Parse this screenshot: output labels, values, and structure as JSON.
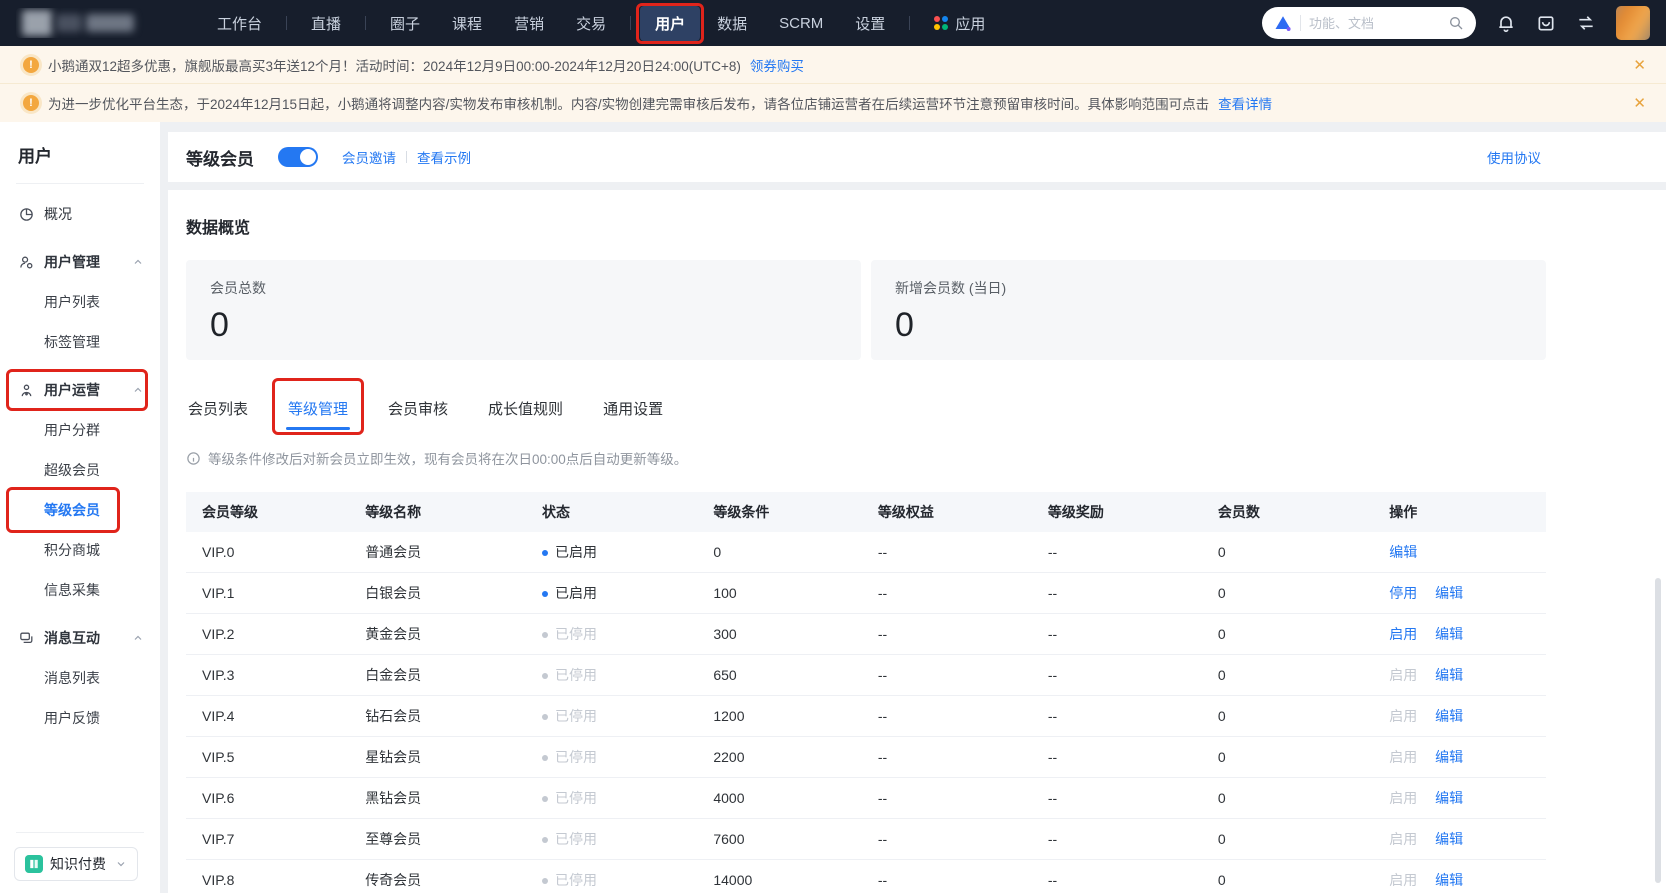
{
  "colors": {
    "accent": "#2478f2",
    "annotation": "#e0241b",
    "warn": "#f3a73f"
  },
  "topnav": {
    "items": [
      "工作台",
      "直播",
      "圈子",
      "课程",
      "营销",
      "交易",
      "用户",
      "数据",
      "SCRM",
      "设置",
      "应用"
    ],
    "active": "用户",
    "search": {
      "placeholder": "功能、文档"
    }
  },
  "banners": {
    "b1": {
      "text": "小鹅通双12超多优惠，旗舰版最高买3年送12个月！活动时间：2024年12月9日00:00-2024年12月20日24:00(UTC+8)",
      "link": "领券购买"
    },
    "b2": {
      "text": "为进一步优化平台生态，于2024年12月15日起，小鹅通将调整内容/实物发布审核机制。内容/实物创建完需审核后发布，请各位店铺运营者在后续运营环节注意预留审核时间。具体影响范围可点击",
      "link": "查看详情"
    }
  },
  "sidebar": {
    "title": "用户",
    "overview": "概况",
    "groups": [
      {
        "label": "用户管理",
        "children": [
          "用户列表",
          "标签管理"
        ]
      },
      {
        "label": "用户运营",
        "children": [
          "用户分群",
          "超级会员",
          "等级会员",
          "积分商城",
          "信息采集"
        ]
      },
      {
        "label": "消息互动",
        "children": [
          "消息列表",
          "用户反馈"
        ]
      }
    ],
    "selected": "等级会员",
    "bottom": {
      "label": "知识付费"
    }
  },
  "header": {
    "title": "等级会员",
    "toggle_on": true,
    "links": [
      "会员邀请",
      "查看示例"
    ],
    "right_link": "使用协议"
  },
  "overview": {
    "title": "数据概览",
    "cards": [
      {
        "label": "会员总数",
        "value": "0"
      },
      {
        "label": "新增会员数 (当日)",
        "value": "0"
      }
    ]
  },
  "tabs": {
    "items": [
      "会员列表",
      "等级管理",
      "会员审核",
      "成长值规则",
      "通用设置"
    ],
    "active": "等级管理"
  },
  "notice": {
    "text": "等级条件修改后对新会员立即生效，现有会员将在次日00:00点后自动更新等级。"
  },
  "table": {
    "columns": [
      "会员等级",
      "等级名称",
      "状态",
      "等级条件",
      "等级权益",
      "等级奖励",
      "会员数",
      "操作"
    ],
    "rows": [
      {
        "level": "VIP.0",
        "name": "普通会员",
        "status": "已启用",
        "condition": "0",
        "benefit": "--",
        "reward": "--",
        "count": "0",
        "actions": [
          {
            "label": "编辑",
            "disabled": false
          }
        ]
      },
      {
        "level": "VIP.1",
        "name": "白银会员",
        "status": "已启用",
        "condition": "100",
        "benefit": "--",
        "reward": "--",
        "count": "0",
        "actions": [
          {
            "label": "停用",
            "disabled": false
          },
          {
            "label": "编辑",
            "disabled": false
          }
        ]
      },
      {
        "level": "VIP.2",
        "name": "黄金会员",
        "status": "已停用",
        "condition": "300",
        "benefit": "--",
        "reward": "--",
        "count": "0",
        "actions": [
          {
            "label": "启用",
            "disabled": false
          },
          {
            "label": "编辑",
            "disabled": false
          }
        ]
      },
      {
        "level": "VIP.3",
        "name": "白金会员",
        "status": "已停用",
        "condition": "650",
        "benefit": "--",
        "reward": "--",
        "count": "0",
        "actions": [
          {
            "label": "启用",
            "disabled": true
          },
          {
            "label": "编辑",
            "disabled": false
          }
        ]
      },
      {
        "level": "VIP.4",
        "name": "钻石会员",
        "status": "已停用",
        "condition": "1200",
        "benefit": "--",
        "reward": "--",
        "count": "0",
        "actions": [
          {
            "label": "启用",
            "disabled": true
          },
          {
            "label": "编辑",
            "disabled": false
          }
        ]
      },
      {
        "level": "VIP.5",
        "name": "星钻会员",
        "status": "已停用",
        "condition": "2200",
        "benefit": "--",
        "reward": "--",
        "count": "0",
        "actions": [
          {
            "label": "启用",
            "disabled": true
          },
          {
            "label": "编辑",
            "disabled": false
          }
        ]
      },
      {
        "level": "VIP.6",
        "name": "黑钻会员",
        "status": "已停用",
        "condition": "4000",
        "benefit": "--",
        "reward": "--",
        "count": "0",
        "actions": [
          {
            "label": "启用",
            "disabled": true
          },
          {
            "label": "编辑",
            "disabled": false
          }
        ]
      },
      {
        "level": "VIP.7",
        "name": "至尊会员",
        "status": "已停用",
        "condition": "7600",
        "benefit": "--",
        "reward": "--",
        "count": "0",
        "actions": [
          {
            "label": "启用",
            "disabled": true
          },
          {
            "label": "编辑",
            "disabled": false
          }
        ]
      },
      {
        "level": "VIP.8",
        "name": "传奇会员",
        "status": "已停用",
        "condition": "14000",
        "benefit": "--",
        "reward": "--",
        "count": "0",
        "actions": [
          {
            "label": "启用",
            "disabled": true
          },
          {
            "label": "编辑",
            "disabled": false
          }
        ]
      }
    ]
  }
}
